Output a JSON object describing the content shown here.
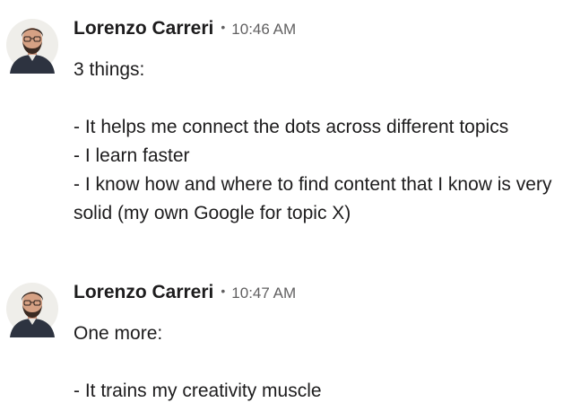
{
  "messages": [
    {
      "author": "Lorenzo Carreri",
      "separator": "•",
      "time": "10:46 AM",
      "avatar_icon": "user-avatar-icon",
      "lines": [
        "3 things:",
        "",
        "- It helps me connect the dots across different topics",
        "- I learn faster",
        "- I know how and where to find content that I know is very solid (my own Google for topic X)"
      ]
    },
    {
      "author": "Lorenzo Carreri",
      "separator": "•",
      "time": "10:47 AM",
      "avatar_icon": "user-avatar-icon",
      "lines": [
        "One more:",
        "",
        "- It trains my creativity muscle"
      ]
    }
  ],
  "colors": {
    "text": "#1d1c1d",
    "muted": "#616061",
    "background": "#ffffff"
  }
}
